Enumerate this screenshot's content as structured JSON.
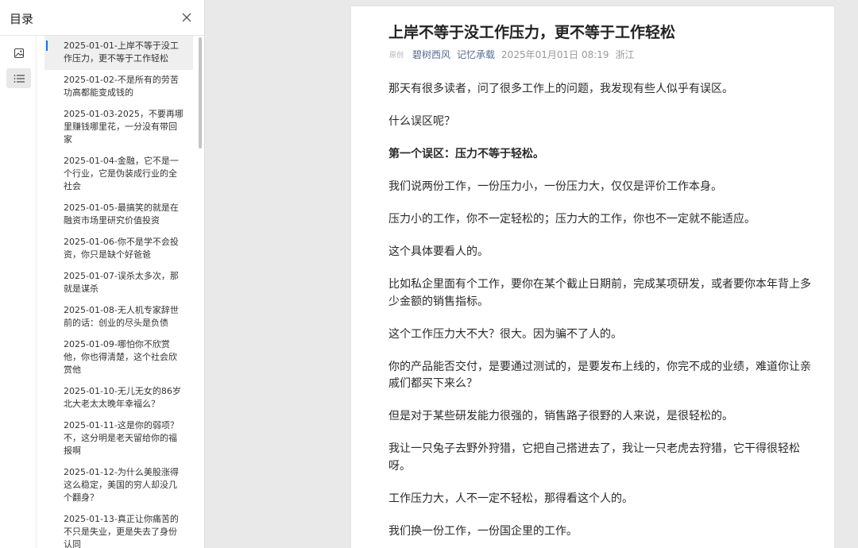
{
  "sidebar": {
    "title": "目录",
    "close_icon": "close-icon",
    "rail": [
      {
        "name": "image-icon"
      },
      {
        "name": "list-icon"
      }
    ],
    "items": [
      {
        "label": "2025-01-01-上岸不等于没工作压力，更不等于工作轻松",
        "active": true
      },
      {
        "label": "2025-01-02-不是所有的劳苦功高都能变成钱的"
      },
      {
        "label": "2025-01-03-2025，不要再哪里赚钱哪里花，一分没有带回家"
      },
      {
        "label": "2025-01-04-金融，它不是一个行业，它是伪装成行业的全社会"
      },
      {
        "label": "2025-01-05-最搞笑的就是在融资市场里研究价值投资"
      },
      {
        "label": "2025-01-06-你不是学不会投资，你只是缺个好爸爸"
      },
      {
        "label": "2025-01-07-误杀太多次，那就是谋杀"
      },
      {
        "label": "2025-01-08-无人机专家辞世前的话：创业的尽头是负债"
      },
      {
        "label": "2025-01-09-哪怕你不欣赏他，你也得清楚，这个社会欣赏他"
      },
      {
        "label": "2025-01-10-无儿无女的86岁北大老太太晚年幸福么？"
      },
      {
        "label": "2025-01-11-这是你的弱项？不，这分明是老天留给你的福报啊"
      },
      {
        "label": "2025-01-12-为什么美股涨得这么稳定，美国的穷人却没几个翻身？"
      },
      {
        "label": "2025-01-13-真正让你痛苦的不只是失业，更是失去了身份认同"
      }
    ]
  },
  "article": {
    "title": "上岸不等于没工作压力，更不等于工作轻松",
    "meta": {
      "tag": "原创",
      "author": "碧树西风",
      "account": "记忆承载",
      "datetime": "2025年01月01日 08:19",
      "location": "浙江"
    },
    "paragraphs": [
      {
        "text": "那天有很多读者，问了很多工作上的问题，我发现有些人似乎有误区。"
      },
      {
        "text": "什么误区呢？"
      },
      {
        "text": "第一个误区：压力不等于轻松。",
        "bold": true
      },
      {
        "text": "我们说两份工作，一份压力小，一份压力大，仅仅是评价工作本身。"
      },
      {
        "text": "压力小的工作，你不一定轻松的；压力大的工作，你也不一定就不能适应。"
      },
      {
        "text": "这个具体要看人的。"
      },
      {
        "text": "比如私企里面有个工作，要你在某个截止日期前，完成某项研发，或者要你本年背上多少金额的销售指标。"
      },
      {
        "text": "这个工作压力大不大？很大。因为骗不了人的。"
      },
      {
        "text": "你的产品能否交付，是要通过测试的，是要发布上线的，你完不成的业绩，难道你让亲戚们都买下来么？"
      },
      {
        "text": "但是对于某些研发能力很强的，销售路子很野的人来说，是很轻松的。"
      },
      {
        "text": "我让一只兔子去野外狩猎，它把自己搭进去了，我让一只老虎去狩猎，它干得很轻松呀。"
      },
      {
        "text": "工作压力大，人不一定不轻松，那得看这个人的。"
      },
      {
        "text": "我们换一份工作，一份国企里的工作。"
      }
    ]
  }
}
